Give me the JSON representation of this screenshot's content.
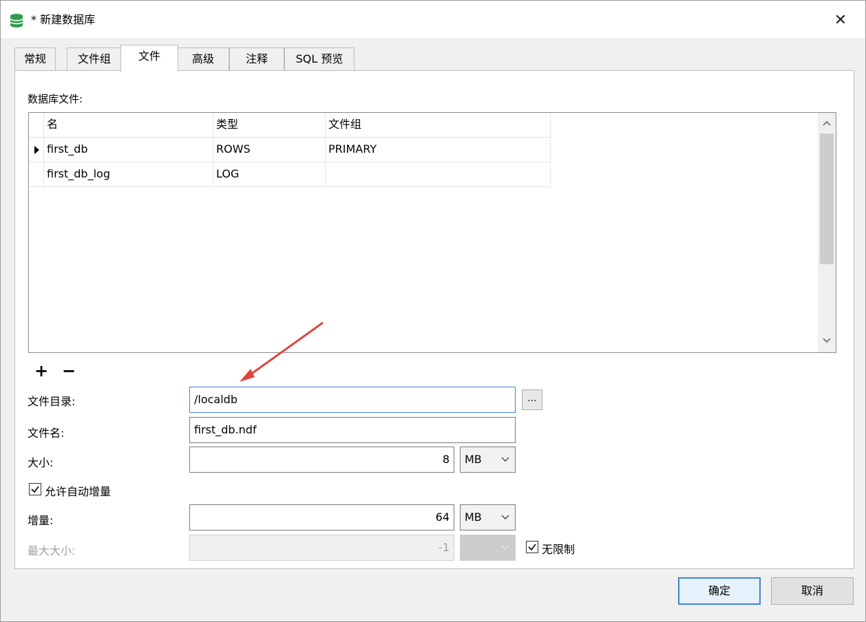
{
  "window": {
    "title": "* 新建数据库",
    "close_glyph": "✕"
  },
  "tabs": [
    {
      "label": "常规"
    },
    {
      "label": "文件组"
    },
    {
      "label": "文件",
      "active": true
    },
    {
      "label": "高级"
    },
    {
      "label": "注释"
    },
    {
      "label": "SQL 预览"
    }
  ],
  "files_section": {
    "label": "数据库文件:",
    "columns": [
      "名",
      "类型",
      "文件组"
    ],
    "rows": [
      {
        "name": "first_db",
        "type": "ROWS",
        "filegroup": "PRIMARY",
        "selected": true
      },
      {
        "name": "first_db_log",
        "type": "LOG",
        "filegroup": ""
      }
    ]
  },
  "toolbar": {
    "add_glyph": "+",
    "remove_glyph": "−"
  },
  "form": {
    "directory_label": "文件目录:",
    "directory_value": "/localdb",
    "browse_label": "...",
    "filename_label": "文件名:",
    "filename_value": "first_db.ndf",
    "size_label": "大小:",
    "size_value": "8",
    "size_unit": "MB",
    "autogrow_label": "允许自动增量",
    "autogrow_checked": true,
    "growth_label": "增量:",
    "growth_value": "64",
    "growth_unit": "MB",
    "maxsize_label": "最大大小:",
    "maxsize_value": "-1",
    "maxsize_unit": "",
    "unlimited_label": "无限制",
    "unlimited_checked": true
  },
  "footer": {
    "ok_label": "确定",
    "cancel_label": "取消"
  },
  "colors": {
    "accent": "#3c84d4",
    "annotation_arrow": "#e0453a",
    "db_icon": "#2e9e4a"
  },
  "icons": {
    "app": "database-icon",
    "close": "close-icon",
    "add": "plus-icon",
    "remove": "minus-icon",
    "row_selected": "row-pointer-icon",
    "scroll_up": "chevron-up-icon",
    "scroll_down": "chevron-down-icon",
    "dropdown": "chevron-down-icon",
    "check": "check-icon"
  }
}
